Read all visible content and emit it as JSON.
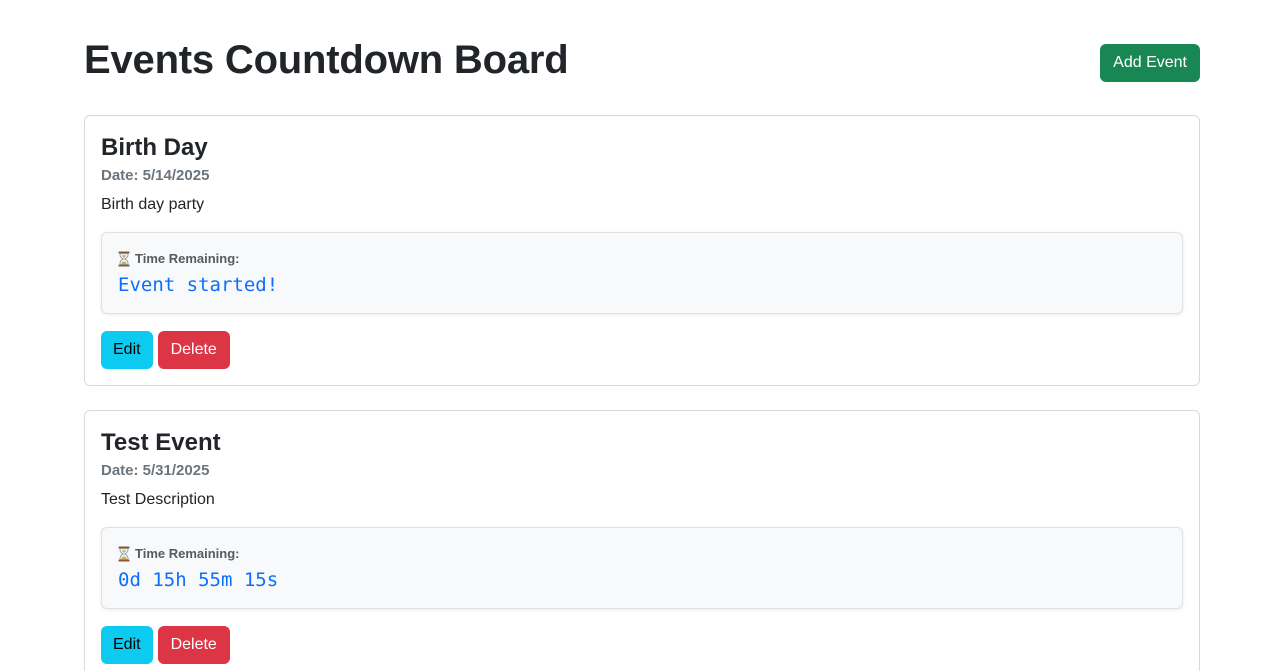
{
  "header": {
    "title": "Events Countdown Board",
    "add_label": "Add Event"
  },
  "events": [
    {
      "title": "Birth Day",
      "date": "Date: 5/14/2025",
      "description": "Birth day party",
      "remaining_label": "Time Remaining:",
      "countdown": "Event started!",
      "edit_label": "Edit",
      "delete_label": "Delete"
    },
    {
      "title": "Test Event",
      "date": "Date: 5/31/2025",
      "description": "Test Description",
      "remaining_label": "Time Remaining:",
      "countdown": "0d 15h 55m 15s",
      "edit_label": "Edit",
      "delete_label": "Delete"
    }
  ],
  "colors": {
    "add_button": "#198754",
    "edit_button": "#0dcaf0",
    "delete_button": "#dc3545",
    "countdown_text": "#0d6efd"
  },
  "icons": {
    "countdown": "hourglass-icon"
  }
}
